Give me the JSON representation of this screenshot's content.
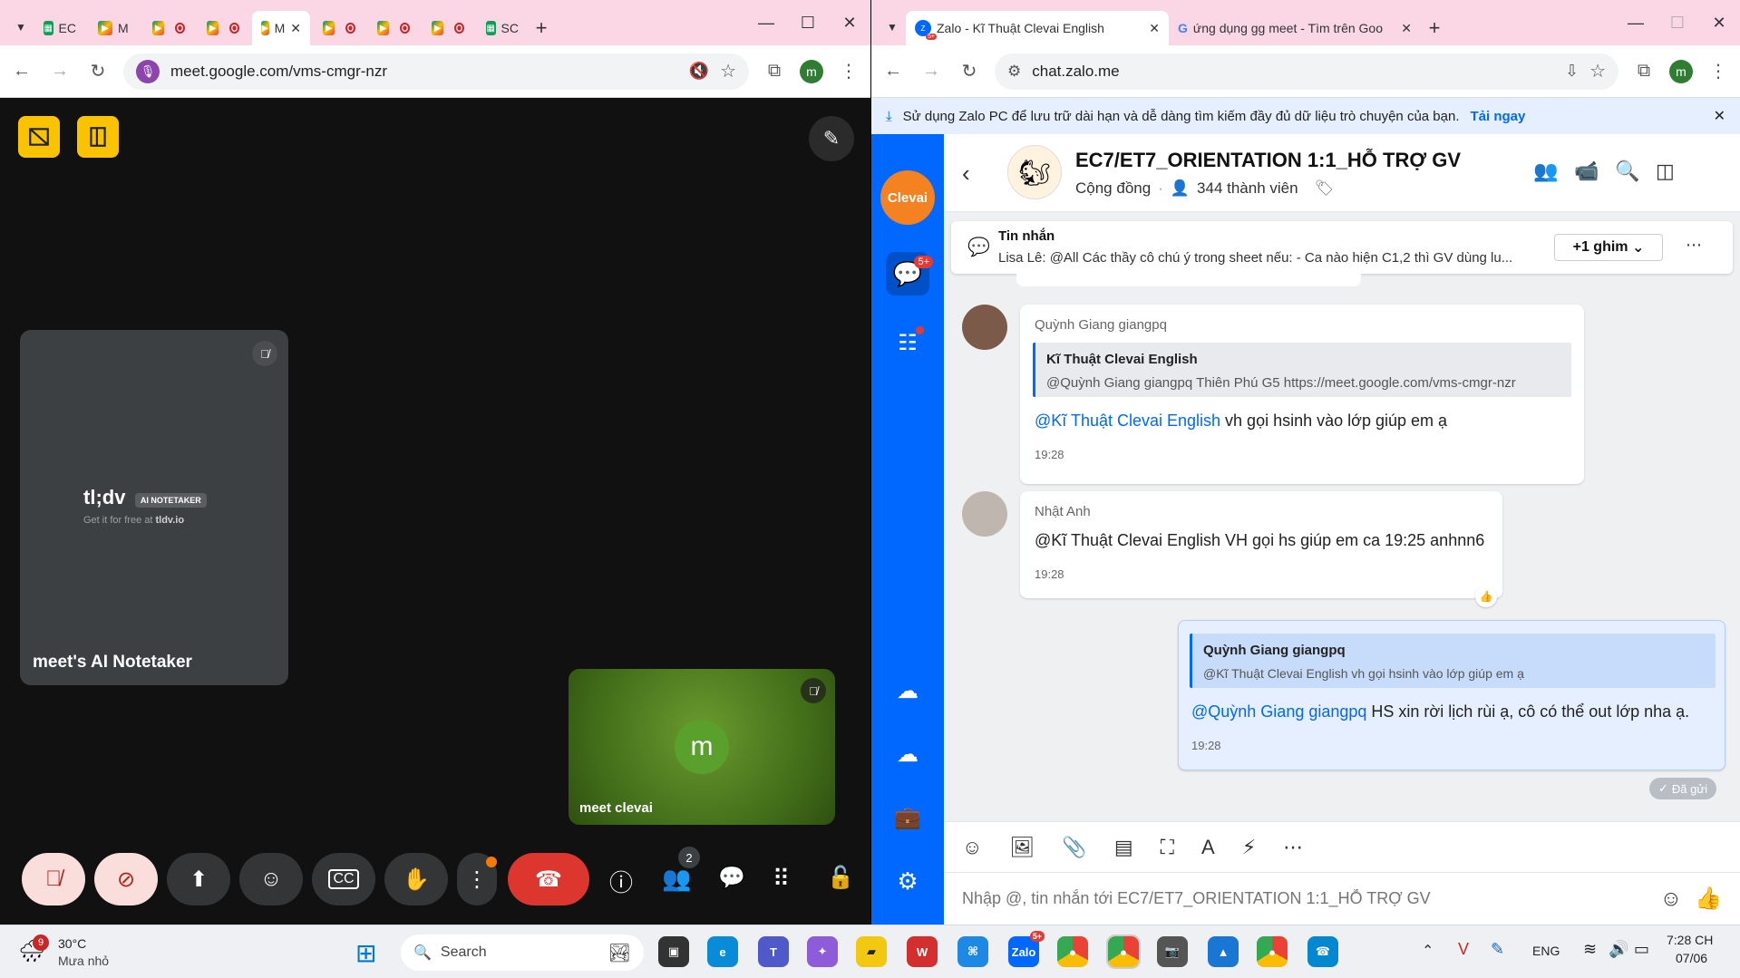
{
  "left_browser": {
    "tabs": [
      {
        "label": "EC",
        "icon": "sheets-icon"
      },
      {
        "label": "M",
        "icon": "meet-icon"
      },
      {
        "label": "",
        "icon": "meet-icon"
      },
      {
        "label": "",
        "icon": "meet-icon"
      },
      {
        "label": "M",
        "icon": "meet-icon",
        "active": true
      },
      {
        "label": "",
        "icon": "meet-icon"
      },
      {
        "label": "",
        "icon": "meet-icon"
      },
      {
        "label": "",
        "icon": "meet-icon"
      },
      {
        "label": "SC",
        "icon": "sheets-icon"
      }
    ],
    "url": "meet.google.com/vms-cmgr-nzr",
    "profile_initial": "m"
  },
  "meet": {
    "notetaker_tile": {
      "brand": "tl;dv",
      "badge": "AI NOTETAKER",
      "tagline_prefix": "Get it for free at",
      "tagline_link": "tldv.io",
      "name": "meet's AI Notetaker"
    },
    "self_tile": {
      "avatar_initial": "m",
      "name": "meet clevai"
    },
    "participants_count": "2"
  },
  "right_browser": {
    "tabs": [
      {
        "label": "Zalo - Kĩ Thuật Clevai English",
        "badge": "5+",
        "active": true
      },
      {
        "label": "ứng dụng gg meet - Tìm trên Goo"
      }
    ],
    "url": "chat.zalo.me",
    "profile_initial": "m"
  },
  "zalo": {
    "banner_text": "Sử dụng Zalo PC để lưu trữ dài hạn và dễ dàng tìm kiếm đầy đủ dữ liệu trò chuyện của bạn.",
    "banner_link": "Tải ngay",
    "logo_text": "Clevai",
    "chat_badge": "5+",
    "group_name": "EC7/ET7_ORIENTATION 1:1_HỖ TRỢ GV",
    "group_type": "Cộng đồng",
    "members": "344 thành viên",
    "pinned": {
      "title": "Tin nhắn",
      "text": "Lisa Lê: @All  Các thầy cô chú ý trong sheet nếu:  - Ca nào hiện C1,2 thì GV dùng lu...",
      "pin_button": "+1 ghim"
    },
    "messages": [
      {
        "sender": "Quỳnh Giang giangpq",
        "quote_author": "Kĩ Thuật Clevai English",
        "quote_text": "@Quỳnh Giang giangpq Thiên Phú G5 https://meet.google.com/vms-cmgr-nzr",
        "mention": "@Kĩ Thuật Clevai English",
        "text": " vh gọi hsinh vào lớp giúp em ạ",
        "time": "19:28"
      },
      {
        "sender": "Nhật Anh",
        "text": "@Kĩ Thuật Clevai English VH gọi hs giúp em ca 19:25 anhnn6",
        "time": "19:28"
      },
      {
        "own": true,
        "quote_author": "Quỳnh Giang giangpq",
        "quote_text": "@Kĩ Thuật Clevai English vh gọi hsinh vào lớp giúp em ạ",
        "mention": "@Quỳnh Giang giangpq",
        "text": " HS xin rời lịch rùi ạ, cô có thể out lớp nha ạ.",
        "time": "19:28"
      }
    ],
    "sent_status": "Đã gửi",
    "input_placeholder": "Nhập @, tin nhắn tới EC7/ET7_ORIENTATION 1:1_HỖ TRỢ GV"
  },
  "taskbar": {
    "weather_temp": "30°C",
    "weather_desc": "Mưa nhỏ",
    "weather_badge": "9",
    "search_placeholder": "Search",
    "zalo_badge": "5+",
    "lang": "ENG",
    "time": "7:28 CH",
    "date": "07/06"
  }
}
